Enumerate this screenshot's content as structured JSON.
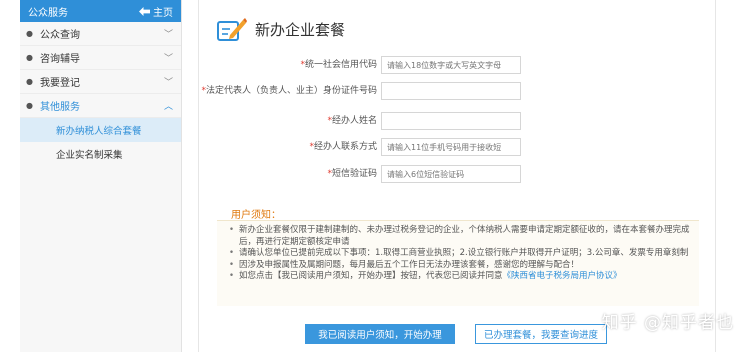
{
  "sidebar": {
    "title": "公众服务",
    "home_icon": "arrow-home-icon",
    "home_label": "主页",
    "items": [
      {
        "label": "公众查询",
        "expanded": false
      },
      {
        "label": "咨询辅导",
        "expanded": false
      },
      {
        "label": "我要登记",
        "expanded": false
      },
      {
        "label": "其他服务",
        "expanded": true
      }
    ],
    "subitems": [
      {
        "label": "新办纳税人综合套餐",
        "selected": true
      },
      {
        "label": "企业实名制采集",
        "selected": false
      }
    ]
  },
  "main": {
    "title": "新办企业套餐",
    "title_icon": "pencil-form-icon",
    "form": {
      "fields": [
        {
          "required": "*",
          "label": "统一社会信用代码",
          "placeholder": "请输入18位数字或大写英文字母"
        },
        {
          "required": "*",
          "label": "法定代表人（负责人、业主）身份证件号码",
          "placeholder": ""
        },
        {
          "required": "*",
          "label": "经办人姓名",
          "placeholder": ""
        },
        {
          "required": "*",
          "label": "经办人联系方式",
          "placeholder": "请输入11位手机号码用于接收短"
        },
        {
          "required": "*",
          "label": "短信验证码",
          "placeholder": "请输入6位短信验证码"
        }
      ]
    },
    "notice": {
      "title": "用户须知：",
      "items": [
        "新办企业套餐仅限于建制建制的、未办理过税务登记的企业，个体纳税人需要申请定期定额征收的，请在本套餐办理完成后，再进行定期定额核定申请",
        "请确认您单位已提前完成以下事项：1.取得工商营业执照；2.设立银行账户并取得开户证明；3.公司章、发票专用章刻制",
        "因涉及申报属性及属期问题，每月最后五个工作日无法办理该套餐，感谢您的理解与配合！"
      ],
      "last_item_prefix": "如您点击【我已阅读用户须知，开始办理】按钮，代表您已阅读并同意",
      "last_item_link": "《陕西省电子税务局用户协议》"
    },
    "buttons": {
      "primary": "我已阅读用户须知，开始办理",
      "secondary": "已办理套餐，我要查询进度"
    }
  },
  "watermark": "知乎 @知乎者也",
  "colors": {
    "accent": "#2f8fd8",
    "required": "#e03c31",
    "notice_title": "#e07a10"
  }
}
